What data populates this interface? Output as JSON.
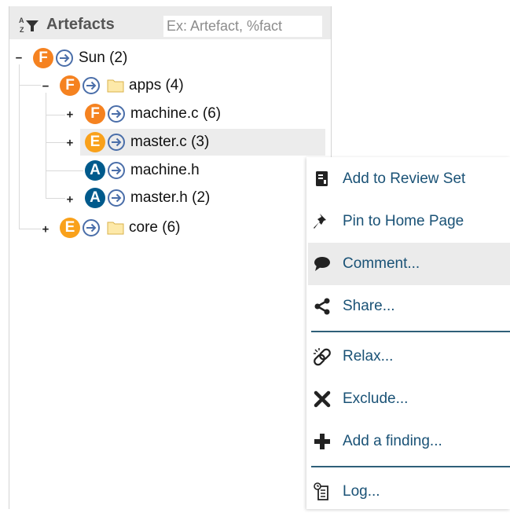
{
  "panel": {
    "title": "Artefacts",
    "search_placeholder": "Ex: Artefact, %fact"
  },
  "tree": {
    "nodes": [
      {
        "label": "Sun (2)",
        "rating": "F",
        "toggle": "−",
        "has_folder": false
      },
      {
        "label": "apps (4)",
        "rating": "F",
        "toggle": "−",
        "has_folder": true
      },
      {
        "label": "machine.c (6)",
        "rating": "F",
        "toggle": "+",
        "has_folder": false
      },
      {
        "label": "master.c (3)",
        "rating": "E",
        "toggle": "+",
        "has_folder": false,
        "selected": true
      },
      {
        "label": "machine.h",
        "rating": "A",
        "toggle": "",
        "has_folder": false
      },
      {
        "label": "master.h (2)",
        "rating": "A",
        "toggle": "+",
        "has_folder": false
      },
      {
        "label": "core (6)",
        "rating": "E",
        "toggle": "+",
        "has_folder": true
      }
    ]
  },
  "context_menu": {
    "items": [
      {
        "label": "Add to Review Set",
        "icon": "review-set-icon"
      },
      {
        "label": "Pin to Home Page",
        "icon": "pin-icon"
      },
      {
        "label": "Comment...",
        "icon": "comment-icon",
        "hover": true
      },
      {
        "label": "Share...",
        "icon": "share-icon"
      },
      {
        "label": "Relax...",
        "icon": "relax-link-icon"
      },
      {
        "label": "Exclude...",
        "icon": "exclude-icon"
      },
      {
        "label": "Add a finding...",
        "icon": "add-finding-icon"
      },
      {
        "label": "Log...",
        "icon": "log-icon"
      }
    ]
  },
  "colors": {
    "rating_F": "#f58220",
    "rating_E": "#f9a11b",
    "rating_A": "#005a8c",
    "menu_text": "#1a5276",
    "separator": "#2f5f79"
  }
}
